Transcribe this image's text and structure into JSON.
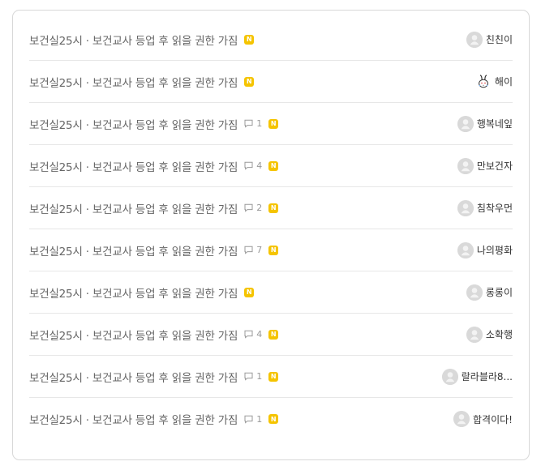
{
  "posts": [
    {
      "title": "보건실25시 · 보건교사 등업 후 읽을 권한 가짐",
      "comments": "",
      "author": "친친이",
      "avatar": "default-avatar-icon",
      "new_badge": "N"
    },
    {
      "title": "보건실25시 · 보건교사 등업 후 읽을 권한 가짐",
      "comments": "",
      "author": "해이",
      "avatar": "rabbit-avatar-icon",
      "new_badge": "N"
    },
    {
      "title": "보건실25시 · 보건교사 등업 후 읽을 권한 가짐",
      "comments": "1",
      "author": "행복네잎",
      "avatar": "default-avatar-icon",
      "new_badge": "N"
    },
    {
      "title": "보건실25시 · 보건교사 등업 후 읽을 권한 가짐",
      "comments": "4",
      "author": "만보건자",
      "avatar": "default-avatar-icon",
      "new_badge": "N"
    },
    {
      "title": "보건실25시 · 보건교사 등업 후 읽을 권한 가짐",
      "comments": "2",
      "author": "침착우먼",
      "avatar": "default-avatar-icon",
      "new_badge": "N"
    },
    {
      "title": "보건실25시 · 보건교사 등업 후 읽을 권한 가짐",
      "comments": "7",
      "author": "나의평화",
      "avatar": "default-avatar-icon",
      "new_badge": "N"
    },
    {
      "title": "보건실25시 · 보건교사 등업 후 읽을 권한 가짐",
      "comments": "",
      "author": "롱롱이",
      "avatar": "default-avatar-icon",
      "new_badge": "N"
    },
    {
      "title": "보건실25시 · 보건교사 등업 후 읽을 권한 가짐",
      "comments": "4",
      "author": "소확행",
      "avatar": "default-avatar-icon",
      "new_badge": "N"
    },
    {
      "title": "보건실25시 · 보건교사 등업 후 읽을 권한 가짐",
      "comments": "1",
      "author": "랄라블라8...",
      "avatar": "default-avatar-icon",
      "new_badge": "N"
    },
    {
      "title": "보건실25시 · 보건교사 등업 후 읽을 권한 가짐",
      "comments": "1",
      "author": "합격이다!",
      "avatar": "default-avatar-icon",
      "new_badge": "N"
    }
  ],
  "colors": {
    "badge": "#f5c400",
    "text": "#666666",
    "author_text": "#333333"
  }
}
